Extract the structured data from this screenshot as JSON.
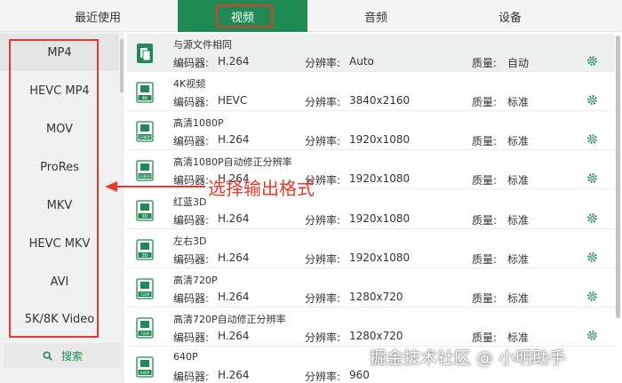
{
  "tabs": [
    {
      "label": "最近使用"
    },
    {
      "label": "视频"
    },
    {
      "label": "音频"
    },
    {
      "label": "设备"
    }
  ],
  "sidebar": {
    "items": [
      {
        "label": "MP4"
      },
      {
        "label": "HEVC MP4"
      },
      {
        "label": "MOV"
      },
      {
        "label": "ProRes"
      },
      {
        "label": "MKV"
      },
      {
        "label": "HEVC MKV"
      },
      {
        "label": "AVI"
      },
      {
        "label": "5K/8K Video"
      }
    ],
    "search_label": "搜索"
  },
  "labels": {
    "encoder": "编码器:",
    "resolution": "分辨率:",
    "quality": "质量:"
  },
  "presets": [
    {
      "title": "与源文件相同",
      "encoder": "H.264",
      "resolution": "Auto",
      "quality": "自动",
      "icon_text": ""
    },
    {
      "title": "4K视频",
      "encoder": "HEVC",
      "resolution": "3840x2160",
      "quality": "标准",
      "icon_text": "4K"
    },
    {
      "title": "高清1080P",
      "encoder": "H.264",
      "resolution": "1920x1080",
      "quality": "标准",
      "icon_text": "1080P"
    },
    {
      "title": "高清1080P自动修正分辨率",
      "encoder": "H.264",
      "resolution": "1920x1080",
      "quality": "标准",
      "icon_text": "1080P"
    },
    {
      "title": "红蓝3D",
      "encoder": "H.264",
      "resolution": "1920x1080",
      "quality": "标准",
      "icon_text": "3D"
    },
    {
      "title": "左右3D",
      "encoder": "H.264",
      "resolution": "1920x1080",
      "quality": "标准",
      "icon_text": "3D"
    },
    {
      "title": "高清720P",
      "encoder": "H.264",
      "resolution": "1280x720",
      "quality": "标准",
      "icon_text": "720P"
    },
    {
      "title": "高清720P自动修正分辨率",
      "encoder": "H.264",
      "resolution": "1280x720",
      "quality": "标准",
      "icon_text": "720P"
    },
    {
      "title": "640P",
      "encoder": "H.264",
      "resolution": "960",
      "quality": "",
      "icon_text": "640P"
    }
  ],
  "annotation": "选择输出格式",
  "watermark": "掘金技术社区 @ 小明助手",
  "colors": {
    "accent": "#1f8a53",
    "highlight": "#e33a2d"
  }
}
